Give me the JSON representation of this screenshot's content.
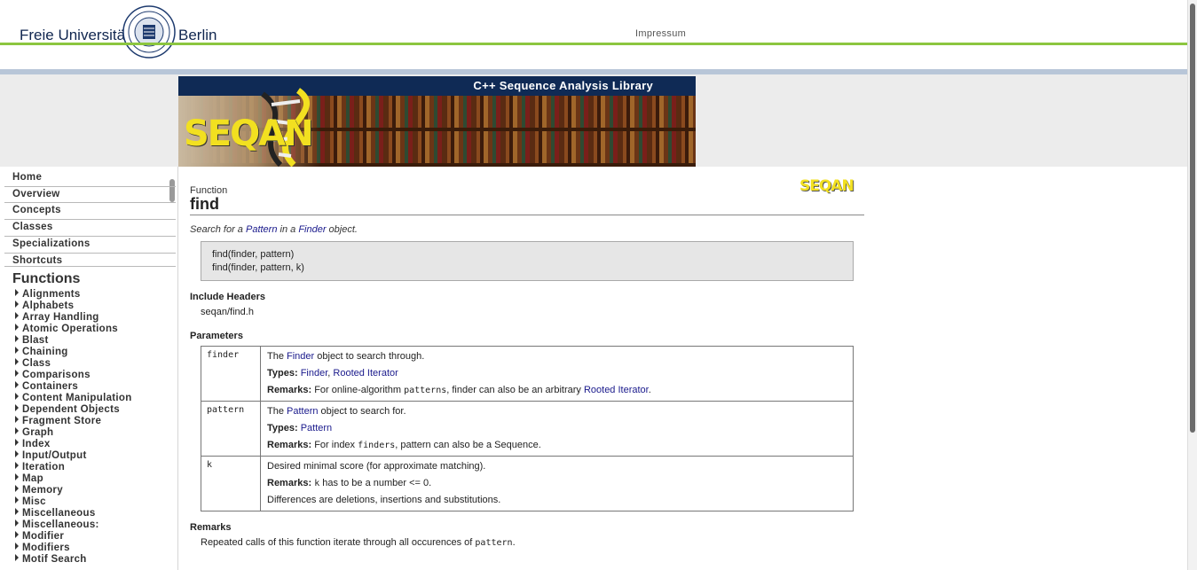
{
  "header": {
    "university_left": "Freie Universität",
    "university_right": "Berlin",
    "impressum": "Impressum"
  },
  "banner": {
    "title": "C++ Sequence Analysis Library",
    "logo_text": "SEQAN"
  },
  "sidebar": {
    "nav": [
      "Home",
      "Overview",
      "Concepts",
      "Classes",
      "Specializations",
      "Shortcuts"
    ],
    "functions_heading": "Functions",
    "functions": [
      "Alignments",
      "Alphabets",
      "Array Handling",
      "Atomic Operations",
      "Blast",
      "Chaining",
      "Class",
      "Comparisons",
      "Containers",
      "Content Manipulation",
      "Dependent Objects",
      "Fragment Store",
      "Graph",
      "Index",
      "Input/Output",
      "Iteration",
      "Map",
      "Memory",
      "Misc",
      "Miscellaneous",
      "Miscellaneous:",
      "Modifier",
      "Modifiers",
      "Motif Search"
    ]
  },
  "page": {
    "kind": "Function",
    "name": "find",
    "logo_text": "SEQAN",
    "summary": {
      "pre": "Search for a ",
      "link1": "Pattern",
      "mid": " in a ",
      "link2": "Finder",
      "post": " object."
    },
    "signatures": [
      "find(finder, pattern)",
      "find(finder, pattern, k)"
    ],
    "include_heading": "Include Headers",
    "include_value": "seqan/find.h",
    "params_heading": "Parameters",
    "params": [
      {
        "name": "finder",
        "desc_pre": "The ",
        "desc_link": "Finder",
        "desc_post": " object to search through.",
        "types_label": "Types:",
        "types": [
          "Finder",
          "Rooted Iterator"
        ],
        "remarks_label": "Remarks:",
        "remarks_pre": " For online-algorithm ",
        "remarks_code": "patterns",
        "remarks_mid": ", finder can also be an arbitrary ",
        "remarks_link": "Rooted Iterator",
        "remarks_post": "."
      },
      {
        "name": "pattern",
        "desc_pre": "The ",
        "desc_link": "Pattern",
        "desc_post": " object to search for.",
        "types_label": "Types:",
        "types": [
          "Pattern"
        ],
        "remarks_label": "Remarks:",
        "remarks_pre": " For index ",
        "remarks_code": "finders",
        "remarks_post": ", pattern can also be a Sequence."
      },
      {
        "name": "k",
        "desc": "Desired minimal score (for approximate matching).",
        "remarks_label": "Remarks:",
        "remarks_code": "k",
        "remarks_post": " has to be a number <= 0.",
        "extra": "Differences are deletions, insertions and substitutions."
      }
    ],
    "remarks_heading": "Remarks",
    "remarks_pre": "Repeated calls of this function iterate through all occurences of ",
    "remarks_code": "pattern",
    "remarks_post": "."
  },
  "colors": {
    "accent_green": "#8cc63f",
    "nav_blue": "#0f2a55",
    "link": "#1a1a8c",
    "logo_yellow": "#f2e020"
  }
}
